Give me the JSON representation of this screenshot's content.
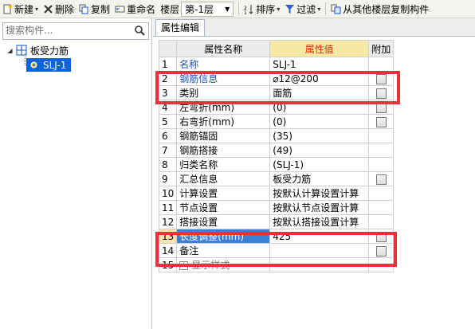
{
  "toolbar": {
    "new_label": "新建",
    "delete_label": "删除",
    "copy_label": "复制",
    "rename_label": "重命名",
    "floor_label": "楼层",
    "floor_value": "第-1层",
    "sort_label": "排序",
    "filter_label": "过滤",
    "copy_from_floor_label": "从其他楼层复制构件"
  },
  "search": {
    "placeholder": "搜索构件..."
  },
  "tree": {
    "root_label": "板受力筋",
    "child_label": "SLJ-1"
  },
  "tab": {
    "label": "属性编辑"
  },
  "grid": {
    "headers": {
      "name": "属性名称",
      "value": "属性值",
      "attach": "附加"
    },
    "rows": [
      {
        "num": "1",
        "name": "名称",
        "value": "SLJ-1"
      },
      {
        "num": "2",
        "name": "钢筋信息",
        "value": "⌀12@200"
      },
      {
        "num": "3",
        "name": "类别",
        "value": "面筋"
      },
      {
        "num": "4",
        "name": "左弯折(mm)",
        "value": "(0)"
      },
      {
        "num": "5",
        "name": "右弯折(mm)",
        "value": "(0)"
      },
      {
        "num": "6",
        "name": "钢筋锚固",
        "value": "(35)"
      },
      {
        "num": "7",
        "name": "钢筋搭接",
        "value": "(49)"
      },
      {
        "num": "8",
        "name": "归类名称",
        "value": "(SLJ-1)"
      },
      {
        "num": "9",
        "name": "汇总信息",
        "value": "板受力筋"
      },
      {
        "num": "10",
        "name": "计算设置",
        "value": "按默认计算设置计算"
      },
      {
        "num": "11",
        "name": "节点设置",
        "value": "按默认节点设置计算"
      },
      {
        "num": "12",
        "name": "搭接设置",
        "value": "按默认搭接设置计算"
      },
      {
        "num": "13",
        "name": "长度调整(mm)",
        "value": "425"
      },
      {
        "num": "14",
        "name": "备注",
        "value": ""
      },
      {
        "num": "15",
        "name": "显示样式",
        "value": ""
      }
    ]
  }
}
